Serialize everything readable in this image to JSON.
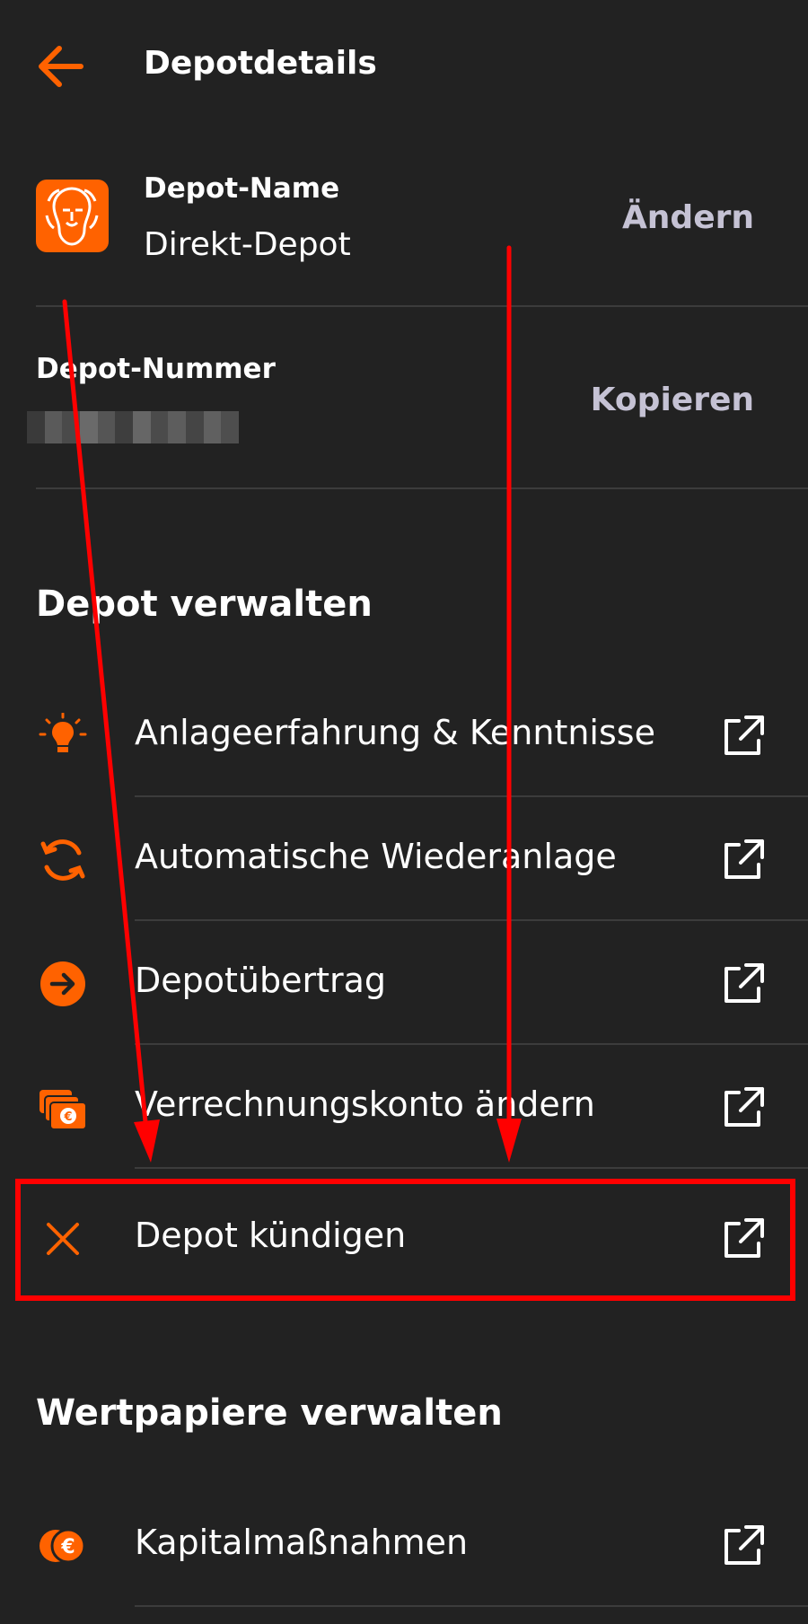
{
  "header": {
    "title": "Depotdetails",
    "back_icon": "arrow-left-icon"
  },
  "depot_name": {
    "label": "Depot-Name",
    "value": "Direkt-Depot",
    "action": "Ändern",
    "logo_icon": "lion-logo-icon"
  },
  "depot_number": {
    "label": "Depot-Nummer",
    "value_state": "pixelated",
    "action": "Kopieren"
  },
  "manage_depot": {
    "title": "Depot verwalten",
    "items": [
      {
        "label": "Anlageerfahrung & Kenntnisse",
        "icon": "lightbulb-icon"
      },
      {
        "label": "Automatische Wiederanlage",
        "icon": "refresh-icon"
      },
      {
        "label": "Depotübertrag",
        "icon": "arrow-right-circle-icon"
      },
      {
        "label": "Verrechnungskonto ändern",
        "icon": "euro-cards-icon"
      },
      {
        "label": "Depot kündigen",
        "icon": "close-icon"
      }
    ]
  },
  "manage_securities": {
    "title": "Wertpapiere verwalten",
    "items": [
      {
        "label": "Kapitalmaßnahmen",
        "icon": "euro-coins-icon"
      }
    ]
  },
  "colors": {
    "accent": "#ff6200",
    "background": "#222222",
    "action_text": "#c5c2d4",
    "annotation": "#ff0000"
  }
}
